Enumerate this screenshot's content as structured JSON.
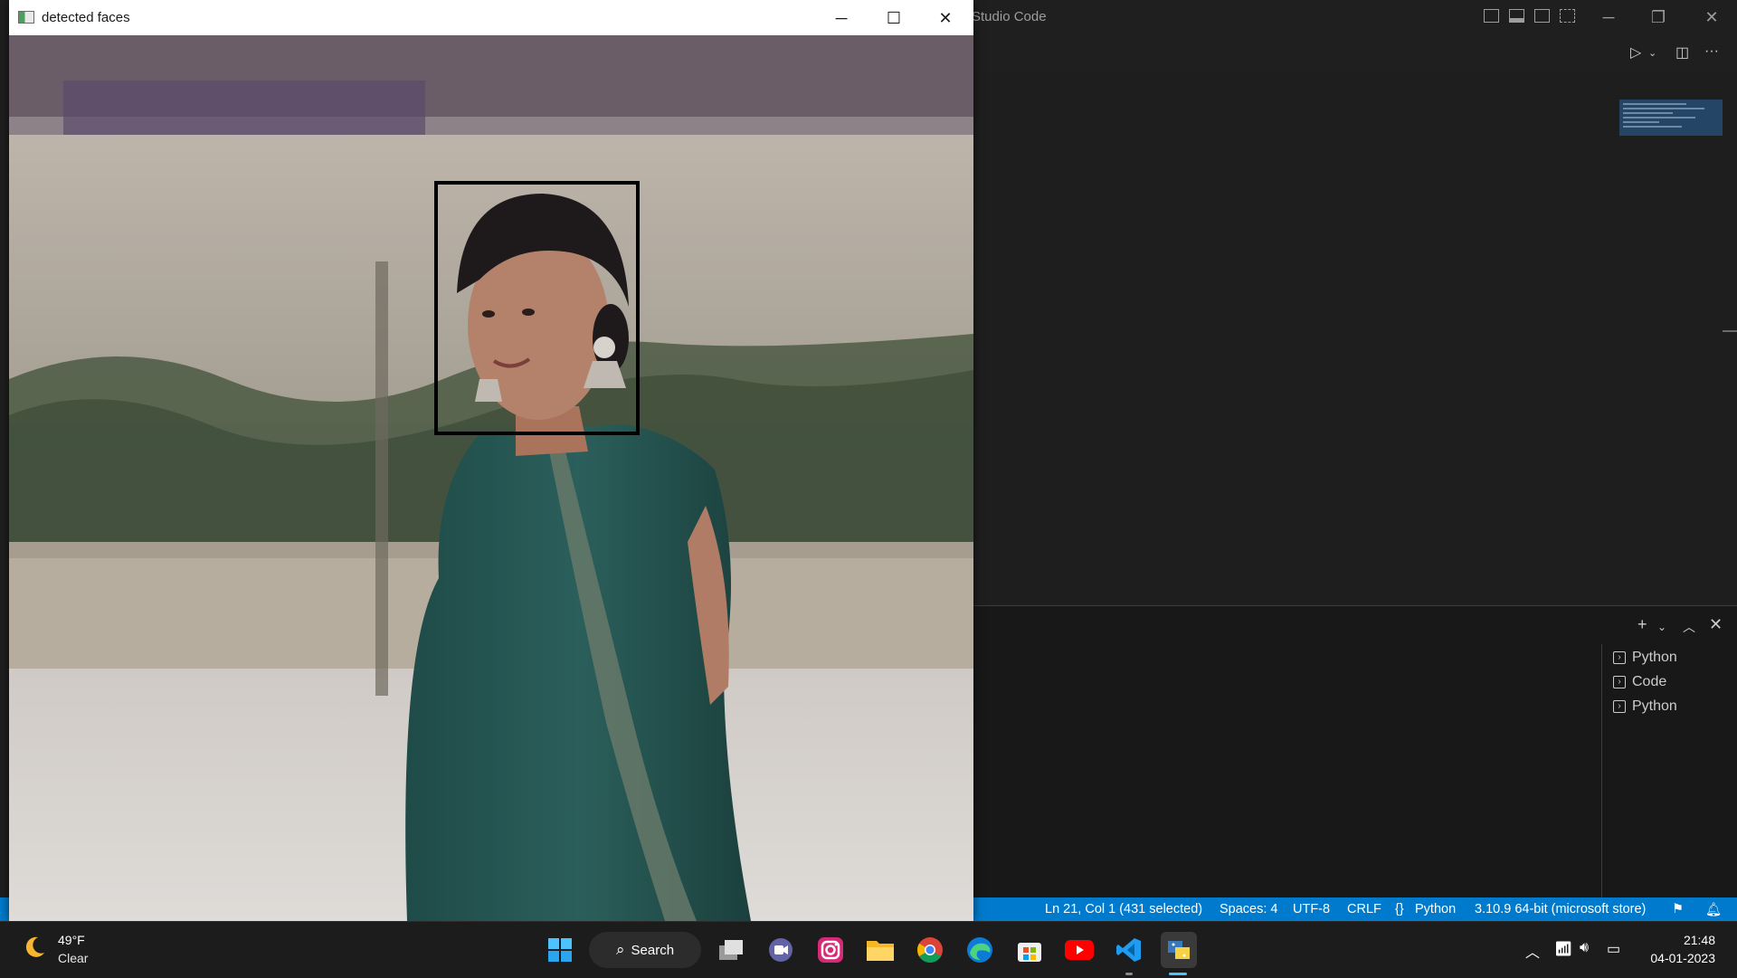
{
  "vscode": {
    "title": "Studio Code",
    "terminals": [
      {
        "label": "Python"
      },
      {
        "label": "Code"
      },
      {
        "label": "Python"
      }
    ],
    "statusbar": {
      "position": "Ln 21, Col 1 (431 selected)",
      "spaces": "Spaces: 4",
      "encoding": "UTF-8",
      "eol": "CRLF",
      "language": "Python",
      "interpreter": "3.10.9 64-bit (microsoft store)"
    },
    "accent": "#007acc"
  },
  "face_window": {
    "title": "detected faces"
  },
  "taskbar": {
    "weather": {
      "temp": "49°F",
      "desc": "Clear"
    },
    "search_label": "Search",
    "time": "21:48",
    "date": "04-01-2023",
    "apps": [
      "start-icon",
      "search",
      "task-view-icon",
      "teams-chat-icon",
      "instagram-icon",
      "file-explorer-icon",
      "chrome-icon",
      "edge-icon",
      "microsoft-store-icon",
      "youtube-icon",
      "vscode-icon",
      "python-icon"
    ]
  }
}
